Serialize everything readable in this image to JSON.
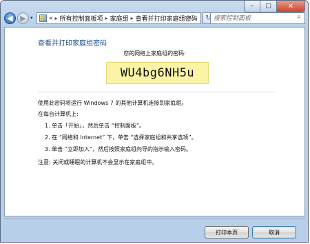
{
  "window": {
    "minimize_glyph": "–",
    "maximize_glyph": "□",
    "close_glyph": "✕"
  },
  "nav": {
    "back_glyph": "◀",
    "forward_glyph": "▶",
    "dropdown_glyph": "▾"
  },
  "address": {
    "prefix": "«",
    "crumbs": [
      "所有控制面板项",
      "家庭组",
      "查看并打印家庭组密码"
    ],
    "separator": "▸",
    "dropdown_glyph": "▾"
  },
  "refresh_glyph": "↻",
  "search": {
    "placeholder": "搜索控制面板",
    "glyph": "⌕"
  },
  "content": {
    "title": "查看并打印家庭组密码",
    "password_label": "您的网络上家庭组的密码:",
    "password": "WU4bg6NH5u",
    "intro": "使用此密码将运行 Windows 7 的其他计算机连接到家庭组。",
    "each_computer": "在每台计算机上:",
    "steps": [
      "1.  单击「开始」，然后单击 “控制面板”。",
      "2.  在 “网络和 Internet” 下，单击 “选择家庭组和共享选项”。",
      "3.  单击 “立即加入”，然后按照家庭组向导的指示输入密码。"
    ],
    "note": "注意: 关闭或睡眠的计算机不会显示在家庭组中。"
  },
  "footer": {
    "print_label": "打印本页",
    "cancel_label": "取消"
  }
}
